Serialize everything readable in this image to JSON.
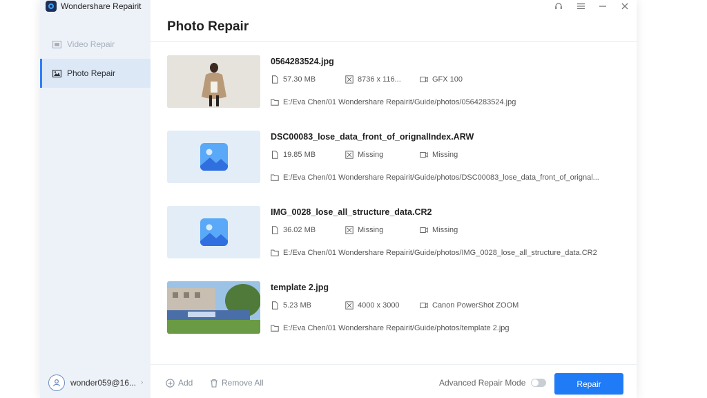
{
  "app": {
    "title": "Wondershare Repairit"
  },
  "sidebar": {
    "items": [
      {
        "label": "Video Repair",
        "icon": "video-icon",
        "active": false
      },
      {
        "label": "Photo Repair",
        "icon": "photo-icon",
        "active": true
      }
    ],
    "user": {
      "name": "wonder059@16...",
      "icon": "user-icon"
    }
  },
  "window_controls": [
    "headset-icon",
    "menu-icon",
    "minimize-icon",
    "close-icon"
  ],
  "main": {
    "title": "Photo Repair",
    "files": [
      {
        "name": "0564283524.jpg",
        "size": "57.30  MB",
        "resolution": "8736 x 116...",
        "camera": "GFX 100",
        "path": "E:/Eva Chen/01 Wondershare Repairit/Guide/photos/0564283524.jpg",
        "thumb": "person"
      },
      {
        "name": "DSC00083_lose_data_front_of_orignalIndex.ARW",
        "size": "19.85  MB",
        "resolution": "Missing",
        "camera": "Missing",
        "path": "E:/Eva Chen/01 Wondershare Repairit/Guide/photos/DSC00083_lose_data_front_of_orignal...",
        "thumb": "placeholder"
      },
      {
        "name": "IMG_0028_lose_all_structure_data.CR2",
        "size": "36.02  MB",
        "resolution": "Missing",
        "camera": "Missing",
        "path": "E:/Eva Chen/01 Wondershare Repairit/Guide/photos/IMG_0028_lose_all_structure_data.CR2",
        "thumb": "placeholder"
      },
      {
        "name": "template 2.jpg",
        "size": "5.23  MB",
        "resolution": "4000 x 3000",
        "camera": "Canon PowerShot ZOOM",
        "path": "E:/Eva Chen/01 Wondershare Repairit/Guide/photos/template 2.jpg",
        "thumb": "street"
      }
    ]
  },
  "footer": {
    "add_label": "Add",
    "remove_all_label": "Remove All",
    "advanced_label": "Advanced Repair Mode",
    "advanced_enabled": false,
    "repair_label": "Repair"
  },
  "colors": {
    "accent": "#1f7bf6",
    "sidebar_bg": "#edf2f9",
    "active_bg": "#dde8f6"
  }
}
